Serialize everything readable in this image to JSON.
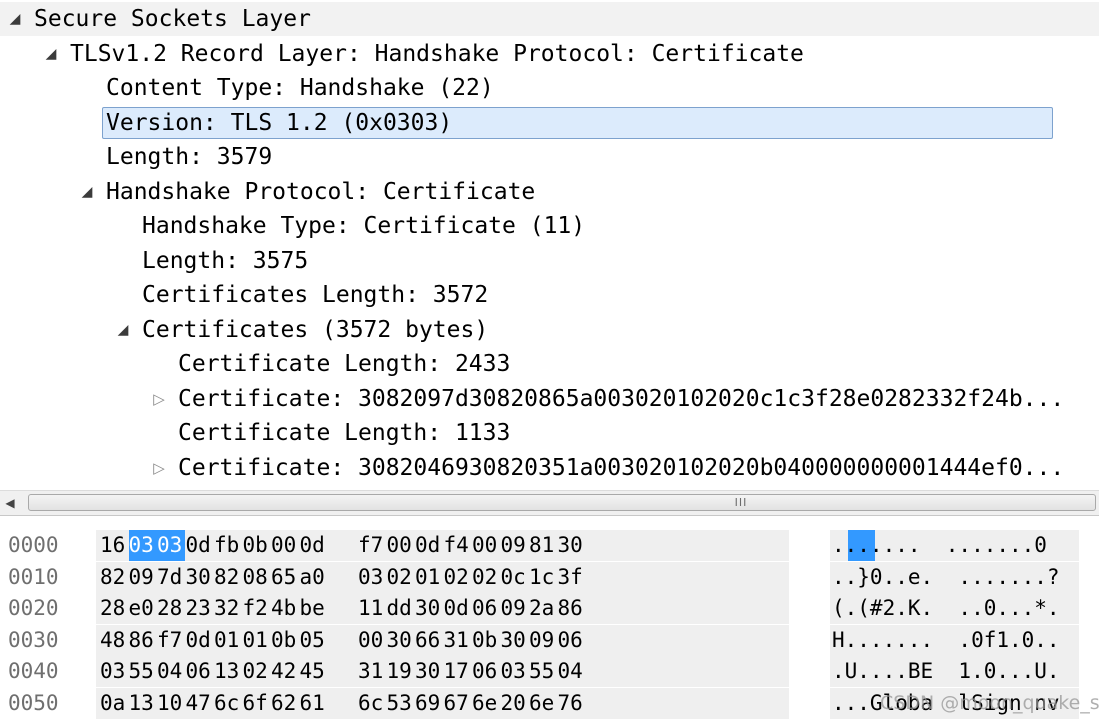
{
  "tree": {
    "rows": [
      {
        "label": "Secure Sockets Layer",
        "expander": "expanded",
        "expander_icon": "triangle-down-icon"
      },
      {
        "label": "TLSv1.2 Record Layer: Handshake Protocol: Certificate",
        "expander": "expanded",
        "expander_icon": "triangle-down-icon"
      },
      {
        "label": "Content Type: Handshake (22)",
        "expander": "none"
      },
      {
        "label": "Version: TLS 1.2 (0x0303)",
        "expander": "none",
        "selected": true
      },
      {
        "label": "Length: 3579",
        "expander": "none"
      },
      {
        "label": "Handshake Protocol: Certificate",
        "expander": "expanded",
        "expander_icon": "triangle-down-icon"
      },
      {
        "label": "Handshake Type: Certificate (11)",
        "expander": "none"
      },
      {
        "label": "Length: 3575",
        "expander": "none"
      },
      {
        "label": "Certificates Length: 3572",
        "expander": "none"
      },
      {
        "label": "Certificates (3572 bytes)",
        "expander": "expanded",
        "expander_icon": "triangle-down-icon"
      },
      {
        "label": "Certificate Length: 2433",
        "expander": "none"
      },
      {
        "label": "Certificate: 3082097d30820865a003020102020c1c3f28e0282332f24b...",
        "expander": "collapsed",
        "expander_icon": "triangle-right-icon"
      },
      {
        "label": "Certificate Length: 1133",
        "expander": "none"
      },
      {
        "label": "Certificate: 3082046930820351a003020102020b040000000001444ef0...",
        "expander": "collapsed",
        "expander_icon": "triangle-right-icon"
      }
    ],
    "expanded_glyph": "◢",
    "collapsed_glyph": "▷"
  },
  "scrollbar": {
    "left_arrow_icon": "arrow-left-icon",
    "left_arrow_glyph": "◀",
    "grip_glyph": "III"
  },
  "hex": {
    "selection_color": "#3399ff",
    "selected_row_bg": "#dcebfc",
    "rows": [
      {
        "offset": "0000",
        "bytes": [
          "16",
          "03",
          "03",
          "0d",
          "fb",
          "0b",
          "00",
          "0d",
          "f7",
          "00",
          "0d",
          "f4",
          "00",
          "09",
          "81",
          "30"
        ],
        "ascii": ".......  .......0",
        "highlight": [
          1,
          2
        ]
      },
      {
        "offset": "0010",
        "bytes": [
          "82",
          "09",
          "7d",
          "30",
          "82",
          "08",
          "65",
          "a0",
          "03",
          "02",
          "01",
          "02",
          "02",
          "0c",
          "1c",
          "3f"
        ],
        "ascii": "..}0..e.  .......?"
      },
      {
        "offset": "0020",
        "bytes": [
          "28",
          "e0",
          "28",
          "23",
          "32",
          "f2",
          "4b",
          "be",
          "11",
          "dd",
          "30",
          "0d",
          "06",
          "09",
          "2a",
          "86"
        ],
        "ascii": "(.(#2.K.  ..0...*."
      },
      {
        "offset": "0030",
        "bytes": [
          "48",
          "86",
          "f7",
          "0d",
          "01",
          "01",
          "0b",
          "05",
          "00",
          "30",
          "66",
          "31",
          "0b",
          "30",
          "09",
          "06"
        ],
        "ascii": "H.......  .0f1.0.."
      },
      {
        "offset": "0040",
        "bytes": [
          "03",
          "55",
          "04",
          "06",
          "13",
          "02",
          "42",
          "45",
          "31",
          "19",
          "30",
          "17",
          "06",
          "03",
          "55",
          "04"
        ],
        "ascii": ".U....BE  1.0...U."
      },
      {
        "offset": "0050",
        "bytes": [
          "0a",
          "13",
          "10",
          "47",
          "6c",
          "6f",
          "62",
          "61",
          "6c",
          "53",
          "69",
          "67",
          "6e",
          "20",
          "6e",
          "76"
        ],
        "ascii": "...Globa  lSign nv"
      }
    ]
  },
  "watermark": "CSDN @moon_quake_s"
}
